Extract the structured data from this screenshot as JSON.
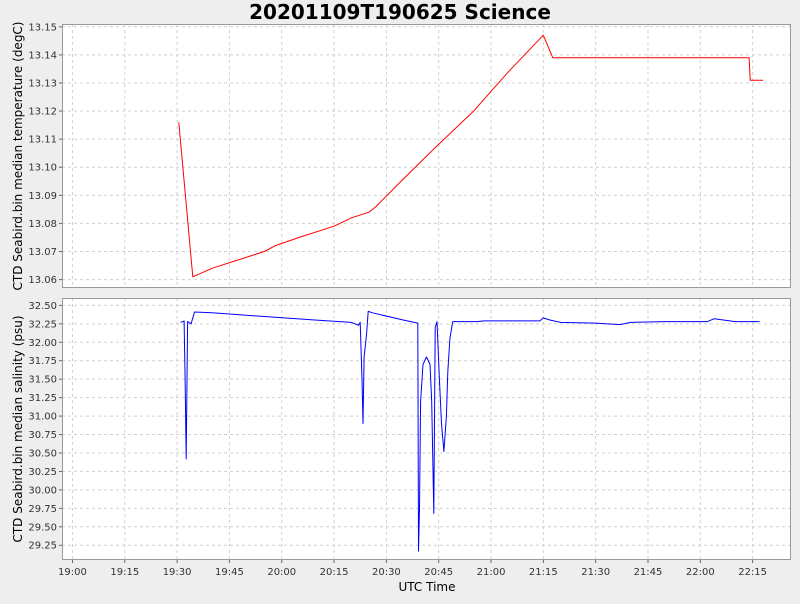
{
  "chart_data": {
    "type": "line",
    "title": "20201109T190625 Science",
    "xlabel": "UTC Time",
    "x_ticks": [
      "19:00",
      "19:15",
      "19:30",
      "19:45",
      "20:00",
      "20:15",
      "20:30",
      "20:45",
      "21:00",
      "21:15",
      "21:30",
      "21:45",
      "22:00",
      "22:15"
    ],
    "x_tick_minutes": [
      0,
      15,
      30,
      45,
      60,
      75,
      90,
      105,
      120,
      135,
      150,
      165,
      180,
      195
    ],
    "x_range_minutes": [
      -3,
      206
    ],
    "grid": true,
    "panels": [
      {
        "ylabel": "CTD Seabird.bin median temperature (degC)",
        "ylim": [
          13.057,
          13.151
        ],
        "y_ticks": [
          13.06,
          13.07,
          13.08,
          13.09,
          13.1,
          13.11,
          13.12,
          13.13,
          13.14,
          13.15
        ],
        "y_tick_labels": [
          "13.06",
          "13.07",
          "13.08",
          "13.09",
          "13.10",
          "13.11",
          "13.12",
          "13.13",
          "13.14",
          "13.15"
        ],
        "color": "#ff0000",
        "series": [
          {
            "x_minutes": [
              30.5,
              34.5,
              40,
              50,
              55,
              58,
              65,
              75,
              80,
              85,
              87,
              95,
              104,
              115,
              125,
              135,
              137.7,
              140,
              150,
              160,
              180,
              194,
              194.3,
              198
            ],
            "values": [
              13.116,
              13.061,
              13.064,
              13.068,
              13.07,
              13.072,
              13.075,
              13.079,
              13.082,
              13.084,
              13.086,
              13.096,
              13.107,
              13.12,
              13.134,
              13.147,
              13.139,
              13.139,
              13.139,
              13.139,
              13.139,
              13.139,
              13.131,
              13.131
            ]
          }
        ]
      },
      {
        "ylabel": "CTD Seabird.bin median salinity (psu)",
        "ylim": [
          29.05,
          32.6
        ],
        "y_ticks": [
          29.25,
          29.5,
          29.75,
          30.0,
          30.25,
          30.5,
          30.75,
          31.0,
          31.25,
          31.5,
          31.75,
          32.0,
          32.25,
          32.5
        ],
        "y_tick_labels": [
          "29.25",
          "29.50",
          "29.75",
          "30.00",
          "30.25",
          "30.50",
          "30.75",
          "31.00",
          "31.25",
          "31.50",
          "31.75",
          "32.00",
          "32.25",
          "32.50"
        ],
        "color": "#0000ff",
        "series": [
          {
            "x_minutes": [
              31,
              32,
              32.3,
              32.6,
              33,
              34,
              35,
              40,
              55,
              70,
              80,
              82,
              82.5,
              83,
              83.3,
              83.6,
              84.3,
              84.8,
              86,
              95,
              99,
              99.2,
              99.5,
              99.8,
              100.5,
              101.5,
              102.5,
              103,
              103.6,
              104,
              104.5,
              105.2,
              105.8,
              106.5,
              107.2,
              107.6,
              108.2,
              109,
              110,
              116,
              118,
              119,
              120,
              134,
              135,
              137,
              140,
              150,
              157,
              160,
              170,
              182,
              184,
              190,
              197
            ],
            "values": [
              32.27,
              32.29,
              31.5,
              30.42,
              32.28,
              32.25,
              32.41,
              32.4,
              32.35,
              32.3,
              32.27,
              32.23,
              32.27,
              31.5,
              30.9,
              31.8,
              32.1,
              32.42,
              32.4,
              32.3,
              32.26,
              29.17,
              29.75,
              31.2,
              31.7,
              31.8,
              31.7,
              31.2,
              29.68,
              32.2,
              32.28,
              31.5,
              30.9,
              30.52,
              31.0,
              31.6,
              32.05,
              32.28,
              32.28,
              32.28,
              32.29,
              32.29,
              32.29,
              32.29,
              32.33,
              32.3,
              32.27,
              32.26,
              32.24,
              32.27,
              32.28,
              32.28,
              32.32,
              32.28,
              32.28
            ]
          }
        ]
      }
    ]
  }
}
